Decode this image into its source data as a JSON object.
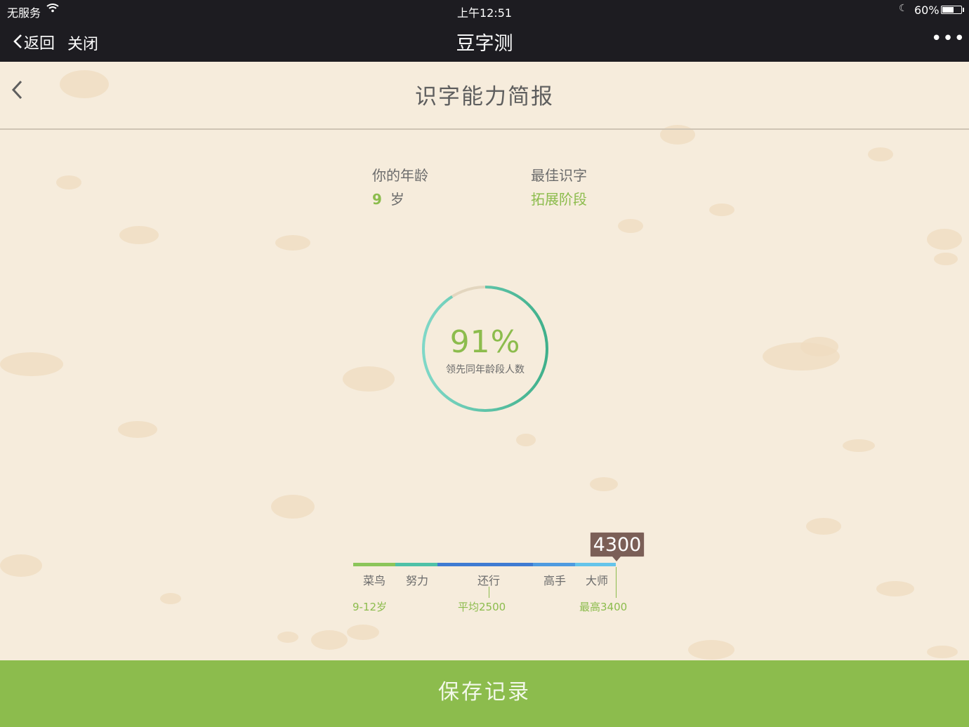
{
  "status_bar": {
    "carrier": "无服务",
    "time": "上午12:51",
    "battery_percent": "60%",
    "battery_level": 0.6
  },
  "nav_bar": {
    "back_label": "返回",
    "close_label": "关闭",
    "title": "豆字测",
    "more_label": "•••"
  },
  "page": {
    "title": "识字能力简报"
  },
  "info": {
    "age_label": "你的年龄",
    "age_value": "9",
    "age_unit": "岁",
    "best_label": "最佳识字",
    "best_value": "拓展阶段"
  },
  "result": {
    "percent": "91%",
    "percent_value": 91,
    "subtitle": "领先同年龄段人数"
  },
  "scale": {
    "score": "4300",
    "levels": [
      "菜鸟",
      "努力",
      "还行",
      "高手",
      "大师"
    ],
    "age_range": "9-12岁",
    "average": "平均2500",
    "highest": "最高3400"
  },
  "colors": {
    "accent_green": "#8cbc4d",
    "teal": "#5bc7b7",
    "blue": "#3f7bd2",
    "light_blue": "#65c4ea",
    "dark_bar": "#1d1c21",
    "background": "#f6ecdc",
    "score_tag": "#7b5f57"
  },
  "actions": {
    "save_label": "保存记录"
  }
}
